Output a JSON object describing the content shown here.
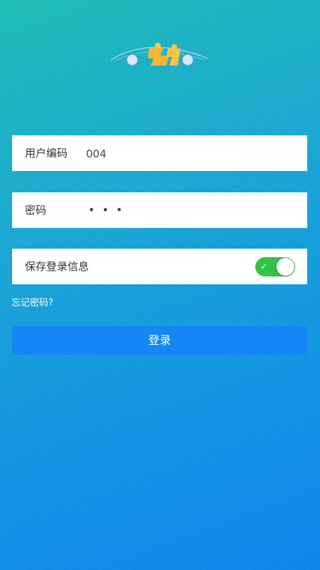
{
  "form": {
    "username": {
      "label": "用户编码",
      "value": "004"
    },
    "password": {
      "label": "密码",
      "masked_value": "•••"
    },
    "remember": {
      "label": "保存登录信息",
      "enabled": true
    }
  },
  "forgot_password_label": "忘记密码?",
  "login_button_label": "登录",
  "colors": {
    "toggle_on": "#34c24a",
    "button": "#1486f5",
    "gradient_top": "#1fbcb5",
    "gradient_bottom": "#0f86ee"
  }
}
